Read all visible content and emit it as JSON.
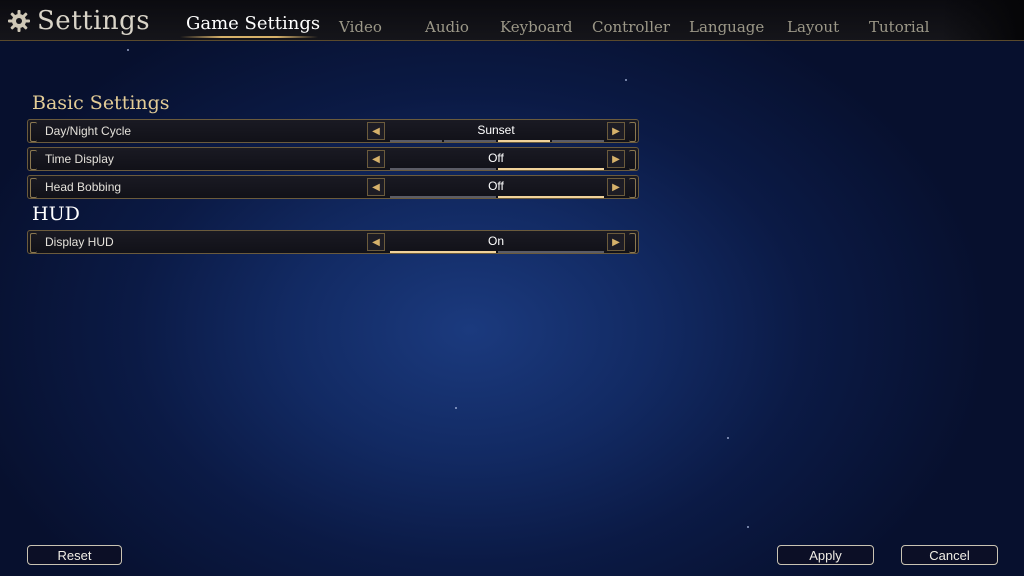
{
  "header": {
    "title": "Settings",
    "tabs": [
      {
        "label": "Game Settings",
        "active": true
      },
      {
        "label": "Video",
        "active": false
      },
      {
        "label": "Audio",
        "active": false
      },
      {
        "label": "Keyboard",
        "active": false
      },
      {
        "label": "Controller",
        "active": false
      },
      {
        "label": "Language",
        "active": false
      },
      {
        "label": "Layout",
        "active": false
      },
      {
        "label": "Tutorial",
        "active": false
      }
    ]
  },
  "sections": {
    "basic": {
      "title": "Basic Settings",
      "rows": [
        {
          "label": "Day/Night Cycle",
          "value": "Sunset",
          "segments": 4,
          "selected_index": 2
        },
        {
          "label": "Time Display",
          "value": "Off",
          "segments": 2,
          "selected_index": 1
        },
        {
          "label": "Head Bobbing",
          "value": "Off",
          "segments": 2,
          "selected_index": 1
        }
      ]
    },
    "hud": {
      "title": "HUD",
      "rows": [
        {
          "label": "Display HUD",
          "value": "On",
          "segments": 2,
          "selected_index": 0
        }
      ]
    }
  },
  "footer": {
    "reset_label": "Reset",
    "apply_label": "Apply",
    "cancel_label": "Cancel"
  },
  "icons": {
    "gear": "gear-icon",
    "prev": "chevron-left-icon",
    "next": "chevron-right-icon"
  },
  "colors": {
    "accent_gold": "#d6b16a",
    "section_gold": "#e3cc96",
    "segment_active": "#f0d29a",
    "segment_inactive": "#5b5c66",
    "background_blue": "#122a63"
  }
}
